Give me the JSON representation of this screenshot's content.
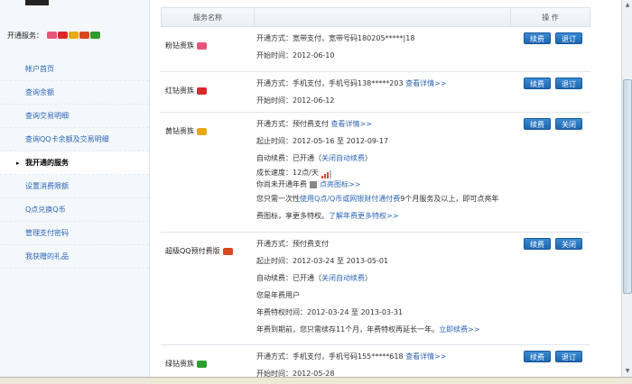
{
  "sidebar": {
    "services_label": "开通服务：",
    "service_icons": [
      {
        "name": "pink-diamond-icon",
        "color": "#e8557a"
      },
      {
        "name": "red-diamond-icon",
        "color": "#d8282c"
      },
      {
        "name": "yellow-diamond-icon",
        "color": "#e9a914"
      },
      {
        "name": "super-qq-icon",
        "color": "#d8461f"
      },
      {
        "name": "green-diamond-icon",
        "color": "#2f9b2f"
      }
    ],
    "menu": [
      {
        "label": "帐户首页",
        "active": false
      },
      {
        "label": "查询余额",
        "active": false
      },
      {
        "label": "查询交易明细",
        "active": false
      },
      {
        "label": "查询QQ卡余额及交易明细",
        "active": false
      },
      {
        "label": "我开通的服务",
        "active": true,
        "marker": "▸"
      },
      {
        "label": "设置消费限额",
        "active": false
      },
      {
        "label": "Q点兑换Q币",
        "active": false
      },
      {
        "label": "管理支付密码",
        "active": false
      },
      {
        "label": "我获赠的礼品",
        "active": false
      }
    ]
  },
  "table": {
    "header_name": "服务名称",
    "header_ops": "操 作",
    "rows": [
      {
        "name": "粉钻贵族",
        "badge_color": "#e8557a",
        "lines": [
          "开通方式：宽带支付，宽带号码180205*****|18",
          "开始时间：2012-06-10"
        ],
        "buttons": [
          "续费",
          "退订"
        ]
      },
      {
        "name": "红钻贵族",
        "badge_color": "#d8282c",
        "line1": "开通方式：手机支付，手机号码138*****203",
        "line1_link": "查看详情>>",
        "line2": "开始时间：2012-06-12",
        "buttons": [
          "续费",
          "退订"
        ]
      },
      {
        "name": "黄钻贵族",
        "badge_color": "#e9a914",
        "line1": "开通方式：预付费支付",
        "line1_link": "查看详情>>",
        "line2": "起止时间：2012-05-16 至 2012-09-17",
        "line3": "自动续费：已开通（",
        "line3_link": "关闭自动续费",
        "line3_end": "）",
        "line4": "成长速度：12点/天",
        "line5": "你尚未开通年费",
        "line5_link": "点亮图标>>",
        "line6": "您只需一次性",
        "line6_link": "使用Q点/Q币或网银财付通付费",
        "line6_end": "9个月服务及以上，即可点亮年",
        "line7": "费图标，享更多特权。",
        "line7_link": "了解年费更多特权>>",
        "buttons": [
          "续费",
          "关闭"
        ]
      },
      {
        "name": "超级QQ预付费版",
        "badge_color": "#d8461f",
        "line1": "开通方式：预付费支付",
        "line2": "起止时间：2012-03-24 至 2013-05-01",
        "line3": "自动续费：已开通（",
        "line3_link": "关闭自动续费",
        "line3_end": "）",
        "line4": "您是年费用户",
        "line5": "年费特权时间：2012-03-24 至 2013-03-31",
        "line6": "年费到期前，您只需续存11个月，年费特权再延长一年。",
        "line6_link": "立即续费>>",
        "buttons": [
          "续费",
          "关闭"
        ]
      },
      {
        "name": "绿钻贵族",
        "badge_color": "#2f9b2f",
        "line1": "开通方式：手机支付，手机号码155*****618",
        "line1_link": "查看详情>>",
        "line2": "开始时间：2012-05-28",
        "buttons": [
          "续费",
          "退订"
        ]
      }
    ]
  },
  "growth_level": 0.6
}
